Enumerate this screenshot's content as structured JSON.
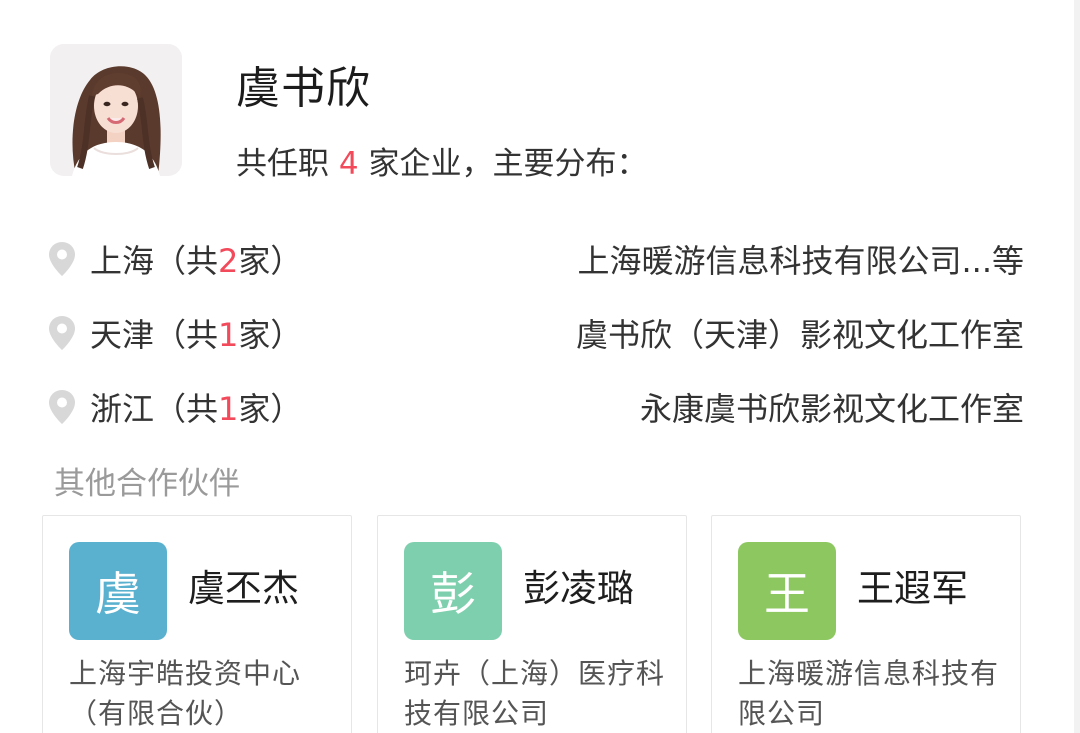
{
  "profile": {
    "name": "虞书欣",
    "summary_prefix": "共任职 ",
    "company_count": "4",
    "summary_suffix": " 家企业，主要分布："
  },
  "regions": [
    {
      "prefix": "上海（共",
      "count": "2",
      "suffix": "家）",
      "company": "上海暖游信息科技有限公司...等"
    },
    {
      "prefix": "天津（共",
      "count": "1",
      "suffix": "家）",
      "company": "虞书欣（天津）影视文化工作室"
    },
    {
      "prefix": "浙江（共",
      "count": "1",
      "suffix": "家）",
      "company": "永康虞书欣影视文化工作室"
    }
  ],
  "partners_title": "其他合作伙伴",
  "partners": [
    {
      "avatar_char": "虞",
      "avatar_color": "#5ab0cf",
      "name": "虞丕杰",
      "company": "上海宇皓投资中心（有限合伙）"
    },
    {
      "avatar_char": "彭",
      "avatar_color": "#7ecfae",
      "name": "彭凌璐",
      "company": "珂卉（上海）医疗科技有限公司"
    },
    {
      "avatar_char": "王",
      "avatar_color": "#8cc760",
      "name": "王遐军",
      "company": "上海暖游信息科技有限公司"
    }
  ],
  "colors": {
    "accent": "#f24a5a",
    "muted": "#9a9a9a"
  },
  "icons": {
    "region": "location-pin-icon"
  }
}
